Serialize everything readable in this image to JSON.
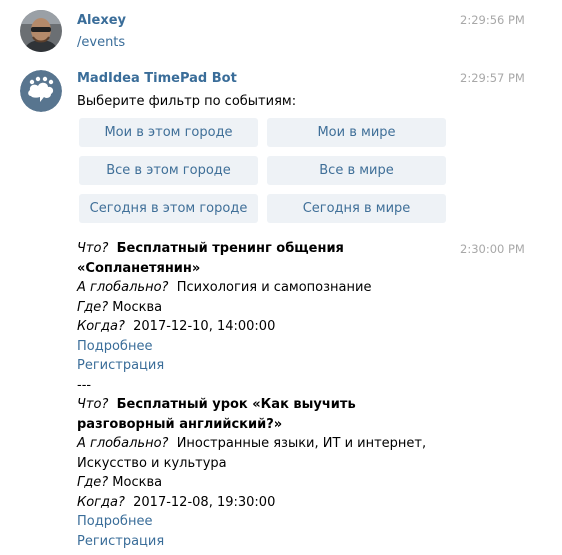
{
  "messages": {
    "user": {
      "name": "Alexey",
      "time": "2:29:56 PM",
      "text": "/events",
      "avatar_icon": "user-photo-avatar"
    },
    "bot": {
      "name": "MadIdea TimePad Bot",
      "time": "2:29:57 PM",
      "text": "Выберите фильтр по событиям:",
      "avatar_icon": "cloud-bot-avatar",
      "avatar_color": "#58758f",
      "keyboard": [
        [
          "Мои в этом городе",
          "Мои в мире"
        ],
        [
          "Все в этом городе",
          "Все в мире"
        ],
        [
          "Сегодня в этом городе",
          "Сегодня в мире"
        ]
      ]
    },
    "events_message": {
      "time": "2:30:00 PM",
      "labels": {
        "what": "Что?",
        "global": "А глобально?",
        "where": "Где?",
        "when": "Когда?",
        "more": "Подробнее",
        "register": "Регистрация",
        "separator": "---"
      },
      "events": [
        {
          "title_line1": "Бесплатный тренинг общения",
          "title_line2": "«Сопланетянин»",
          "category_line1": "Психология и самопознание",
          "category_line2": "",
          "place": "Москва",
          "datetime": "2017-12-10, 14:00:00"
        },
        {
          "title_line1": "Бесплатный урок «Как выучить",
          "title_line2": "разговорный английский?»",
          "category_line1": "Иностранные языки, ИТ и интернет,",
          "category_line2": "Искусство и культура",
          "place": "Москва",
          "datetime": "2017-12-08, 19:30:00"
        }
      ]
    }
  },
  "colors": {
    "name_link": "#3a6d99",
    "timestamp": "#a8a8a8",
    "keyboard_bg": "#eef2f6"
  }
}
